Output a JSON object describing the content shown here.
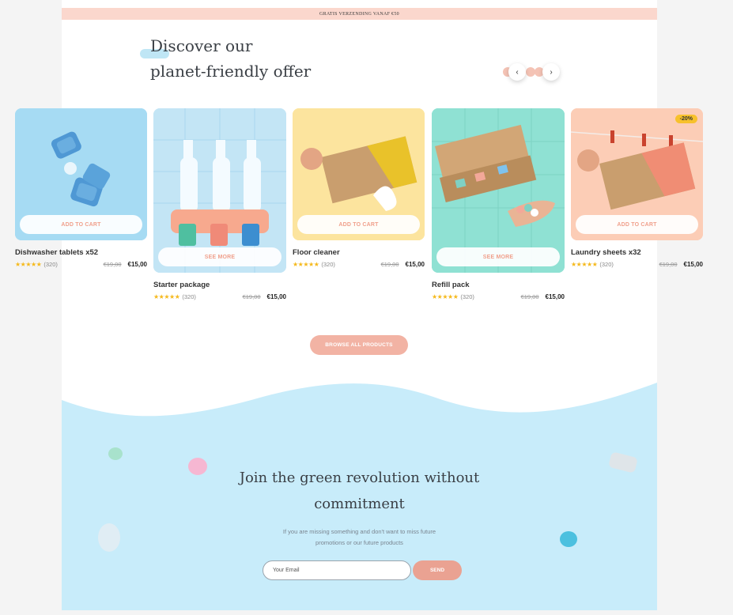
{
  "announcement": {
    "text": "GRATIS VERZENDING VANAF €50"
  },
  "hero": {
    "title_line1": "Discover our",
    "title_line2": "planet-friendly offer"
  },
  "carousel": {
    "prev_glyph": "‹",
    "next_glyph": "›"
  },
  "products": [
    {
      "name": "Dishwasher tablets x52",
      "stars": "★★★★★",
      "reviews": "(320)",
      "old_price": "€19,00",
      "price": "€15,00",
      "cta": "ADD TO CART",
      "bg": "#9fd8f2"
    },
    {
      "name": "Starter package",
      "stars": "★★★★★",
      "reviews": "(320)",
      "old_price": "€19,00",
      "price": "€15,00",
      "cta": "SEE MORE",
      "bg": "#bfe3f4"
    },
    {
      "name": "Floor cleaner",
      "stars": "★★★★★",
      "reviews": "(320)",
      "old_price": "€19,00",
      "price": "€15,00",
      "cta": "ADD TO CART",
      "bg": "#fbe39a"
    },
    {
      "name": "Refill pack",
      "stars": "★★★★★",
      "reviews": "(320)",
      "old_price": "€19,00",
      "price": "€15,00",
      "cta": "SEE MORE",
      "bg": "#8ee0d2"
    },
    {
      "name": "Laundry sheets x32",
      "stars": "★★★★★",
      "reviews": "(320)",
      "old_price": "€19,00",
      "price": "€15,00",
      "cta": "ADD TO CART",
      "bg": "#fbcbb3",
      "badge": "-20%"
    }
  ],
  "browse_button": "BROWSE ALL PRODUCTS",
  "newsletter": {
    "title_line1": "Join the green revolution without",
    "title_line2": "commitment",
    "text_line1": "If you are missing something and don't want to miss future",
    "text_line2": "promotions or our future products",
    "placeholder": "Your Email",
    "send": "SEND"
  },
  "colors": {
    "accent": "#f2b3a4",
    "sky": "#c8ecfa",
    "banner": "#fbd7cd",
    "star": "#f5b91c"
  }
}
